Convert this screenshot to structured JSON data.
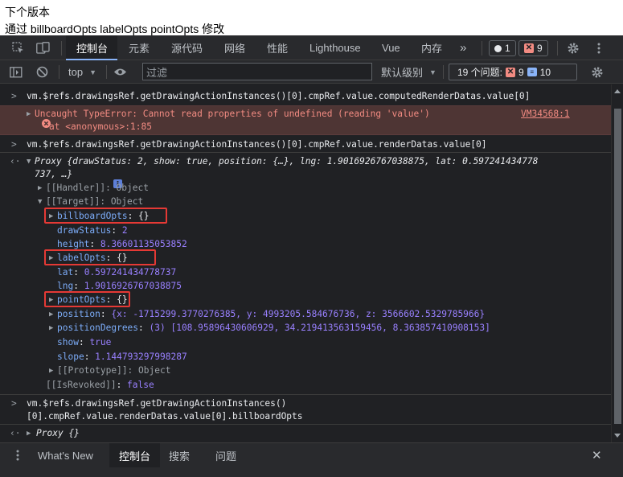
{
  "header": {
    "line1": "下个版本",
    "line2": "通过 billboardOpts labelOpts pointOpts 修改"
  },
  "tabs": {
    "items": [
      "控制台",
      "元素",
      "源代码",
      "网络",
      "性能",
      "Lighthouse",
      "Vue",
      "内存"
    ],
    "more": "»",
    "warn_count": "1",
    "err_count": "9"
  },
  "toolbar": {
    "context": "top",
    "filter_placeholder": "过滤",
    "levels": "默认级别",
    "issues_label": "19 个问题:",
    "issues_err": "9",
    "issues_info": "10"
  },
  "console": {
    "cmd1": "vm.$refs.drawingsRef.getDrawingActionInstances()[0].cmpRef.value.computedRenderDatas.value[0]",
    "err_msg": "Uncaught TypeError: Cannot read properties of undefined (reading 'value')",
    "err_loc": "at <anonymous>:1:85",
    "err_link": "VM34568:1",
    "cmd2": "vm.$refs.drawingsRef.getDrawingActionInstances()[0].cmpRef.value.renderDatas.value[0]",
    "proxy_line1": "Proxy {drawStatus: 2, show: true, position: {…}, lng: 1.9016926767038875, lat: 0.597241434778",
    "proxy_line2": "737, …}",
    "handler": "[[Handler]]: Object",
    "target": "[[Target]]: Object",
    "props": {
      "billboardOpts": "billboardOpts",
      "drawStatus_k": "drawStatus",
      "drawStatus_v": "2",
      "height_k": "height",
      "height_v": "8.36601135053852",
      "labelOpts": "labelOpts",
      "lat_k": "lat",
      "lat_v": "0.597241434778737",
      "lng_k": "lng",
      "lng_v": "1.9016926767038875",
      "pointOpts": "pointOpts",
      "position_k": "position",
      "position_v": "{x: -1715299.3770276385, y: 4993205.584676736, z: 3566602.5329785966}",
      "posDeg_k": "positionDegrees",
      "posDeg_v": "(3) [108.95896430606929, 34.219413563159456, 8.363857410908153]",
      "show_k": "show",
      "show_v": "true",
      "slope_k": "slope",
      "slope_v": "1.144793297998287",
      "empty_obj": "{}"
    },
    "prototype": "[[Prototype]]: Object",
    "revoked_k": "[[IsRevoked]]",
    "revoked_v": "false",
    "cmd3a": "vm.$refs.drawingsRef.getDrawingActionInstances()",
    "cmd3b": "[0].cmpRef.value.renderDatas.value[0].billboardOpts",
    "proxy_empty": "Proxy {}"
  },
  "drawer": {
    "tabs": [
      "What's New",
      "控制台",
      "搜索",
      "问题"
    ],
    "close": "✕"
  },
  "colors": {
    "accent": "#8ab4f8",
    "error_bg": "#4e3534",
    "highlight_box": "#e53935"
  }
}
